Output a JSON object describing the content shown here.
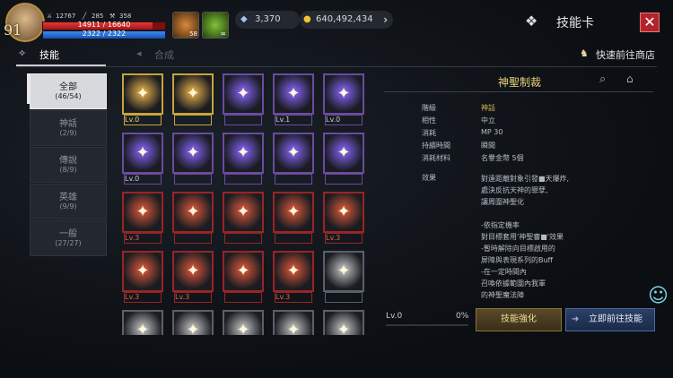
{
  "player": {
    "level": "91",
    "stat_a": "12767",
    "stat_b": "285",
    "stat_c": "358",
    "hp_text": "14911 / 16640",
    "hp_pct": 0.896,
    "mp_text": "2322 / 2322",
    "mp_pct": 1.0,
    "buff1_count": "58",
    "buff2_count": "∞"
  },
  "currency": {
    "diamonds": "3,370",
    "gold": "640,492,434"
  },
  "header": {
    "title": "技能卡"
  },
  "tabs": {
    "skill": "技能",
    "synth": "合成",
    "shop": "快速前往商店"
  },
  "categories": [
    {
      "name": "全部",
      "count": "(46/54)"
    },
    {
      "name": "神話",
      "count": "(2/9)"
    },
    {
      "name": "傳說",
      "count": "(8/9)"
    },
    {
      "name": "英雄",
      "count": "(9/9)"
    },
    {
      "name": "一般",
      "count": "(27/27)"
    }
  ],
  "cards": [
    {
      "lv": "Lv.0",
      "tier": "gold",
      "icon": "burst-icon"
    },
    {
      "lv": "",
      "tier": "gold",
      "icon": "holy-light-icon"
    },
    {
      "lv": "",
      "tier": "purple",
      "icon": "star-seal-icon"
    },
    {
      "lv": "Lv.1",
      "tier": "purple",
      "icon": "star-emblem-icon"
    },
    {
      "lv": "Lv.0",
      "tier": "purple",
      "icon": "cross-shield-icon"
    },
    {
      "lv": "Lv.0",
      "tier": "purple",
      "icon": "holy-book-icon"
    },
    {
      "lv": "",
      "tier": "purple",
      "icon": "blade-slash-icon"
    },
    {
      "lv": "",
      "tier": "purple",
      "icon": "xiv-shield-icon"
    },
    {
      "lv": "",
      "tier": "purple",
      "icon": "cross-book-icon"
    },
    {
      "lv": "",
      "tier": "purple",
      "icon": "angel-wings-icon"
    },
    {
      "lv": "Lv.3",
      "tier": "red",
      "icon": "cross-orb-icon"
    },
    {
      "lv": "",
      "tier": "red",
      "icon": "prayer-hands-icon"
    },
    {
      "lv": "",
      "tier": "red",
      "icon": "xiv-shield-icon"
    },
    {
      "lv": "",
      "tier": "red",
      "icon": "holy-book-icon"
    },
    {
      "lv": "Lv.3",
      "tier": "red",
      "icon": "cross-book-icon"
    },
    {
      "lv": "Lv.3",
      "tier": "red",
      "icon": "whirl-ring-icon"
    },
    {
      "lv": "Lv.3",
      "tier": "red",
      "icon": "sword-strike-icon"
    },
    {
      "lv": "",
      "tier": "red",
      "icon": "exp-badge-icon"
    },
    {
      "lv": "Lv.3",
      "tier": "red",
      "icon": "wing-slash-icon"
    },
    {
      "lv": "",
      "tier": "gray",
      "icon": "shield-icon"
    },
    {
      "lv": "",
      "tier": "gray",
      "icon": "lightning-icon"
    },
    {
      "lv": "",
      "tier": "gray",
      "icon": "spiral-icon"
    },
    {
      "lv": "",
      "tier": "gray",
      "icon": "light-burst-icon"
    },
    {
      "lv": "",
      "tier": "gray",
      "icon": "anchor-icon"
    },
    {
      "lv": "",
      "tier": "gray",
      "icon": "light-beam-icon"
    }
  ],
  "detail": {
    "name": "神聖制裁",
    "rows": [
      {
        "label": "階級",
        "value": "神話"
      },
      {
        "label": "相性",
        "value": "中立"
      },
      {
        "label": "消耗",
        "value": "MP 30"
      },
      {
        "label": "持續時間",
        "value": "瞬間"
      },
      {
        "label": "消耗材料",
        "value": "名譽金幣 5個"
      }
    ],
    "effect_label": "效果",
    "effect_text": "對遠距離對象引發■天爆炸,\n處決反抗天神的罪孽,\n讓周圍神聖化\n\n-依指定機率\n對目標套用'神聖審■'效果\n-暫時解除向目標啟用的\n屏障與表現系列的Buff\n-在一定時間內\n召喚依據範圍內我軍\n的神聖魔法陣",
    "level": "Lv.0",
    "progress": "0%",
    "enhance": "技能強化",
    "goto": "立即前往技能"
  },
  "colors": {
    "gold": "#c9a43a",
    "purple": "#5a3a86",
    "red": "#8a1f1f",
    "gray": "#4a4f57",
    "accent": "#e8d17a"
  }
}
